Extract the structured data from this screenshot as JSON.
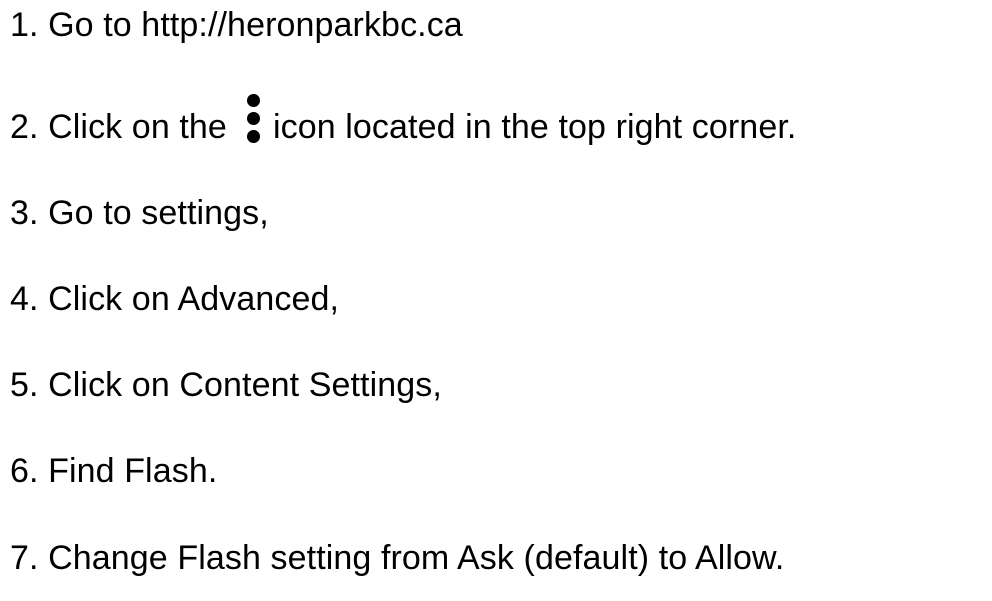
{
  "steps": [
    {
      "text": "1. Go to http://heronparkbc.ca"
    },
    {
      "before_icon": "2. Click on the",
      "icon": "vertical-dots-menu-icon",
      "after_icon": "icon located in the top right corner."
    },
    {
      "text": "3. Go to settings,"
    },
    {
      "text": "4. Click on Advanced,"
    },
    {
      "text": "5. Click on Content Settings,"
    },
    {
      "text": "6. Find Flash."
    },
    {
      "text": "7. Change Flash setting from Ask (default) to Allow."
    }
  ]
}
